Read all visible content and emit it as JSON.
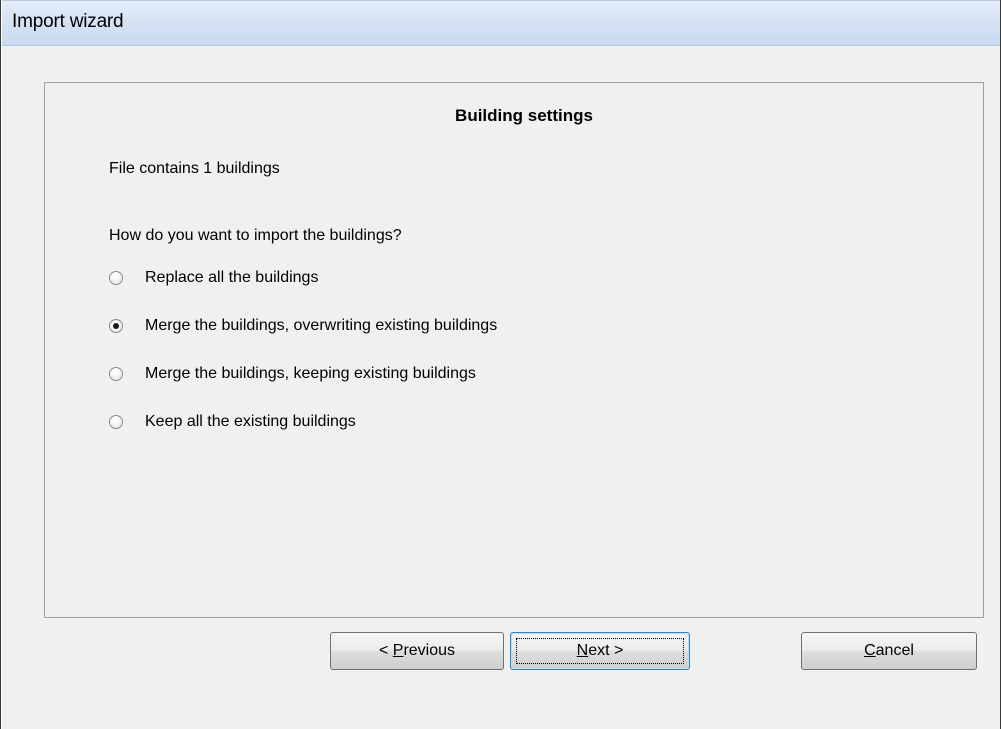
{
  "window": {
    "title": "Import wizard"
  },
  "panel": {
    "heading": "Building settings",
    "file_info": "File contains 1 buildings",
    "question": "How do you want to import the buildings?",
    "options": [
      {
        "label": "Replace all the buildings",
        "checked": false
      },
      {
        "label": "Merge the buildings, overwriting existing buildings",
        "checked": true
      },
      {
        "label": "Merge the buildings, keeping existing buildings",
        "checked": false
      },
      {
        "label": "Keep all the existing buildings",
        "checked": false
      }
    ]
  },
  "buttons": {
    "previous": {
      "prefix": "< ",
      "mnemonic": "P",
      "rest": "revious"
    },
    "next": {
      "prefix": "",
      "mnemonic": "N",
      "rest": "ext >"
    },
    "cancel": {
      "prefix": "",
      "mnemonic": "C",
      "rest": "ancel"
    }
  }
}
